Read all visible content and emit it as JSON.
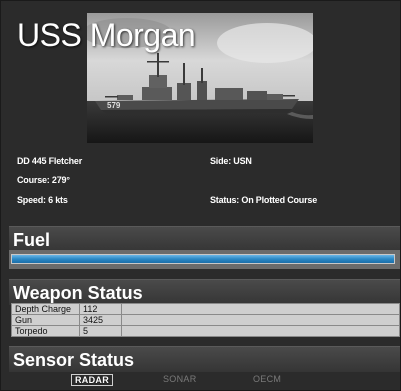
{
  "ship": {
    "name": "USS Morgan",
    "hull_number": "579",
    "designation": "DD 445 Fletcher",
    "side": "Side: USN",
    "course": "Course: 279°",
    "speed": "Speed: 6 kts",
    "status": "Status: On Plotted Course"
  },
  "fuel": {
    "title": "Fuel",
    "level": 1.0
  },
  "weapons": {
    "title": "Weapon Status",
    "rows": [
      {
        "name": "Depth Charge",
        "count": "112"
      },
      {
        "name": "Gun",
        "count": "3425"
      },
      {
        "name": "Torpedo",
        "count": "5"
      }
    ]
  },
  "sensors": {
    "title": "Sensor Status",
    "items": [
      {
        "label": "RADAR",
        "active": true
      },
      {
        "label": "SONAR",
        "active": false
      },
      {
        "label": "OECM",
        "active": false
      }
    ]
  },
  "colors": {
    "panel": "#2b2b2b",
    "fuel_bar": "#2a88c6",
    "active_sensor": "#ffffff",
    "inactive_sensor": "#7a7a7a"
  }
}
